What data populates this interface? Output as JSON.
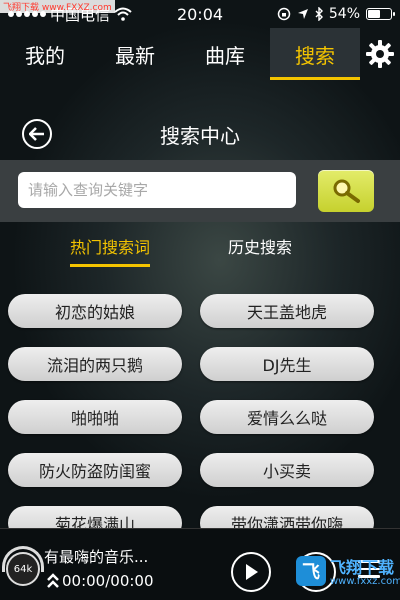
{
  "watermark": "飞翔下载 www.FXXZ.com",
  "status_bar": {
    "carrier": "中国电信",
    "time": "20:04",
    "battery": "54%",
    "battery_level": 0.54
  },
  "nav": {
    "tabs": [
      {
        "label": "我的"
      },
      {
        "label": "最新"
      },
      {
        "label": "曲库"
      },
      {
        "label": "搜索"
      }
    ],
    "active_tab": "搜索"
  },
  "header": {
    "title": "搜索中心"
  },
  "search": {
    "placeholder": "请输入查询关键字",
    "value": ""
  },
  "sub_tabs": {
    "hot": "热门搜索词",
    "history": "历史搜索",
    "active": "热门搜索词"
  },
  "keywords": [
    "初恋的姑娘",
    "天王盖地虎",
    "流泪的两只鹅",
    "DJ先生",
    "啪啪啪",
    "爱情么么哒",
    "防火防盗防闺蜜",
    "小买卖",
    "菊花爆满山",
    "带你潇洒带你嗨"
  ],
  "player": {
    "quality": "64k",
    "song_title": "有最嗨的音乐...",
    "time": "00:00/00:00"
  },
  "logo": {
    "text": "飞翔下载",
    "url": "www.fxxz.com"
  },
  "colors": {
    "accent": "#f4c400",
    "search_button": "#d4dd3c",
    "pill": "#e2e2e2"
  }
}
